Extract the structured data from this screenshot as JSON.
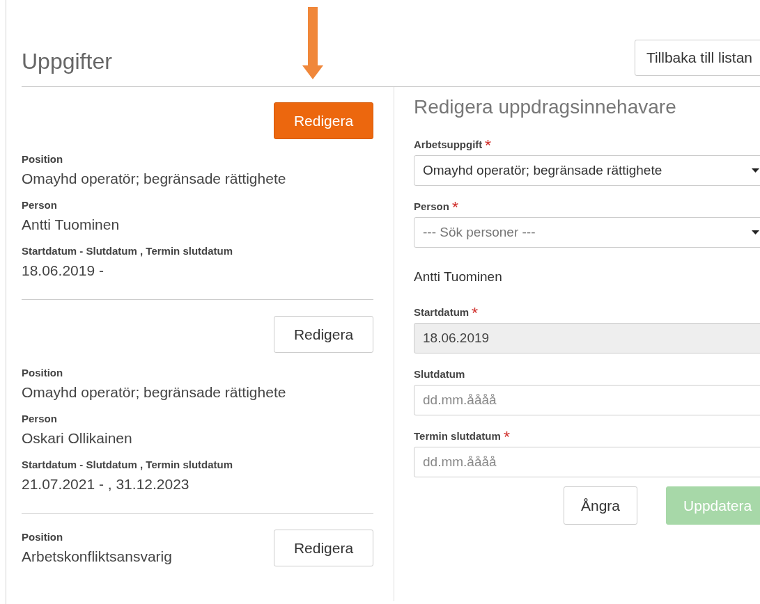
{
  "header": {
    "title": "Uppgifter",
    "back_button": "Tillbaka till listan"
  },
  "records": [
    {
      "edit_button": "Redigera",
      "highlighted": true,
      "fields": [
        {
          "label": "Position",
          "value": "Omayhd operatör; begränsade rättighete"
        },
        {
          "label": "Person",
          "value": "Antti Tuominen"
        },
        {
          "label": "Startdatum - Slutdatum , Termin slutdatum",
          "value": "18.06.2019 -"
        }
      ]
    },
    {
      "edit_button": "Redigera",
      "highlighted": false,
      "fields": [
        {
          "label": "Position",
          "value": "Omayhd operatör; begränsade rättighete"
        },
        {
          "label": "Person",
          "value": "Oskari Ollikainen"
        },
        {
          "label": "Startdatum - Slutdatum , Termin slutdatum",
          "value": "21.07.2021 - , 31.12.2023"
        }
      ]
    },
    {
      "edit_button": "Redigera",
      "highlighted": false,
      "fields": [
        {
          "label": "Position",
          "value": "Arbetskonfliktsansvarig"
        }
      ]
    }
  ],
  "form": {
    "title": "Redigera uppdragsinnehavare",
    "fields": [
      {
        "kind": "select",
        "label": "Arbetsuppgift",
        "required": true,
        "value": "Omayhd operatör; begränsade rättighete"
      },
      {
        "kind": "select",
        "label": "Person",
        "required": true,
        "placeholder": "--- Sök personer ---"
      },
      {
        "kind": "text",
        "value": "Antti Tuominen"
      },
      {
        "kind": "input",
        "label": "Startdatum",
        "required": true,
        "disabled": true,
        "value": "18.06.2019"
      },
      {
        "kind": "input",
        "label": "Slutdatum",
        "disabled": false,
        "placeholder": "dd.mm.åååå"
      },
      {
        "kind": "input",
        "label": "Termin slutdatum",
        "required": true,
        "disabled": false,
        "placeholder": "dd.mm.åååå"
      }
    ],
    "buttons": [
      {
        "label": "Ångra",
        "kind": "secondary",
        "disabled": false
      },
      {
        "label": "Uppdatera",
        "kind": "primary",
        "disabled": true
      }
    ]
  }
}
